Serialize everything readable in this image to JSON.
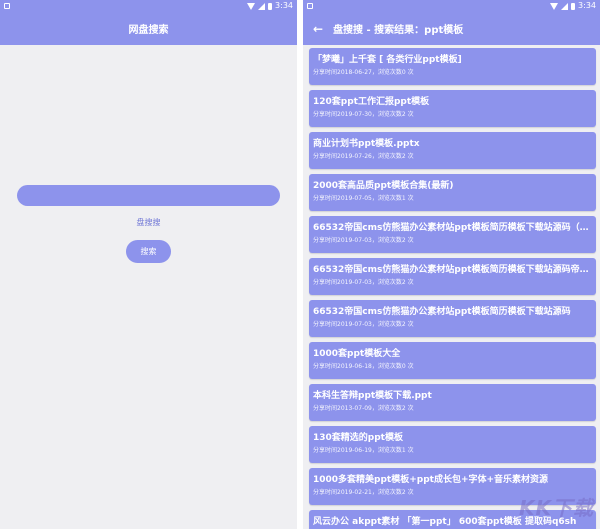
{
  "colors": {
    "accent": "#8d93ec",
    "background": "#efeff2",
    "hint": "#6f76d6"
  },
  "statusbar": {
    "time": "3:34"
  },
  "left": {
    "title": "网盘搜索",
    "search": {
      "value": "",
      "placeholder": ""
    },
    "hint": "盘搜搜",
    "button_label": "搜索"
  },
  "right": {
    "title": "盘搜搜 - 搜索结果：ppt模板",
    "results": [
      {
        "title": "「梦曦」上千套 [ 各类行业ppt模板]",
        "meta": "分享时间2018-06-27，浏览次数0 次"
      },
      {
        "title": "120套ppt工作汇报ppt模板",
        "meta": "分享时间2019-07-30，浏览次数2 次"
      },
      {
        "title": "商业计划书ppt模板.pptx",
        "meta": "分享时间2019-07-26，浏览次数2 次"
      },
      {
        "title": "2000套高品质ppt模板合集(最新)",
        "meta": "分享时间2019-07-05，浏览次数1 次"
      },
      {
        "title": "66532帝国cms仿熊猫办公素材站ppt模板简历模板下载站源码（帝…",
        "meta": "分享时间2019-07-03，浏览次数2 次"
      },
      {
        "title": "66532帝国cms仿熊猫办公素材站ppt模板简历模板下载站源码帝国c…",
        "meta": "分享时间2019-07-03，浏览次数2 次"
      },
      {
        "title": "66532帝国cms仿熊猫办公素材站ppt模板简历模板下载站源码",
        "meta": "分享时间2019-07-03，浏览次数2 次"
      },
      {
        "title": "1000套ppt模板大全",
        "meta": "分享时间2019-06-18，浏览次数0 次"
      },
      {
        "title": "本科生答辩ppt模板下载.ppt",
        "meta": "分享时间2013-07-09，浏览次数2 次"
      },
      {
        "title": "130套精选的ppt模板",
        "meta": "分享时间2019-06-19，浏览次数1 次"
      },
      {
        "title": "1000多套精美ppt模板+ppt成长包+字体+音乐素材资源",
        "meta": "分享时间2019-02-21，浏览次数2 次"
      },
      {
        "title": "风云办公 akppt素材 「第一ppt」 600套ppt模板 提取码q6sh",
        "meta": ""
      }
    ]
  },
  "watermark": "KK下载"
}
